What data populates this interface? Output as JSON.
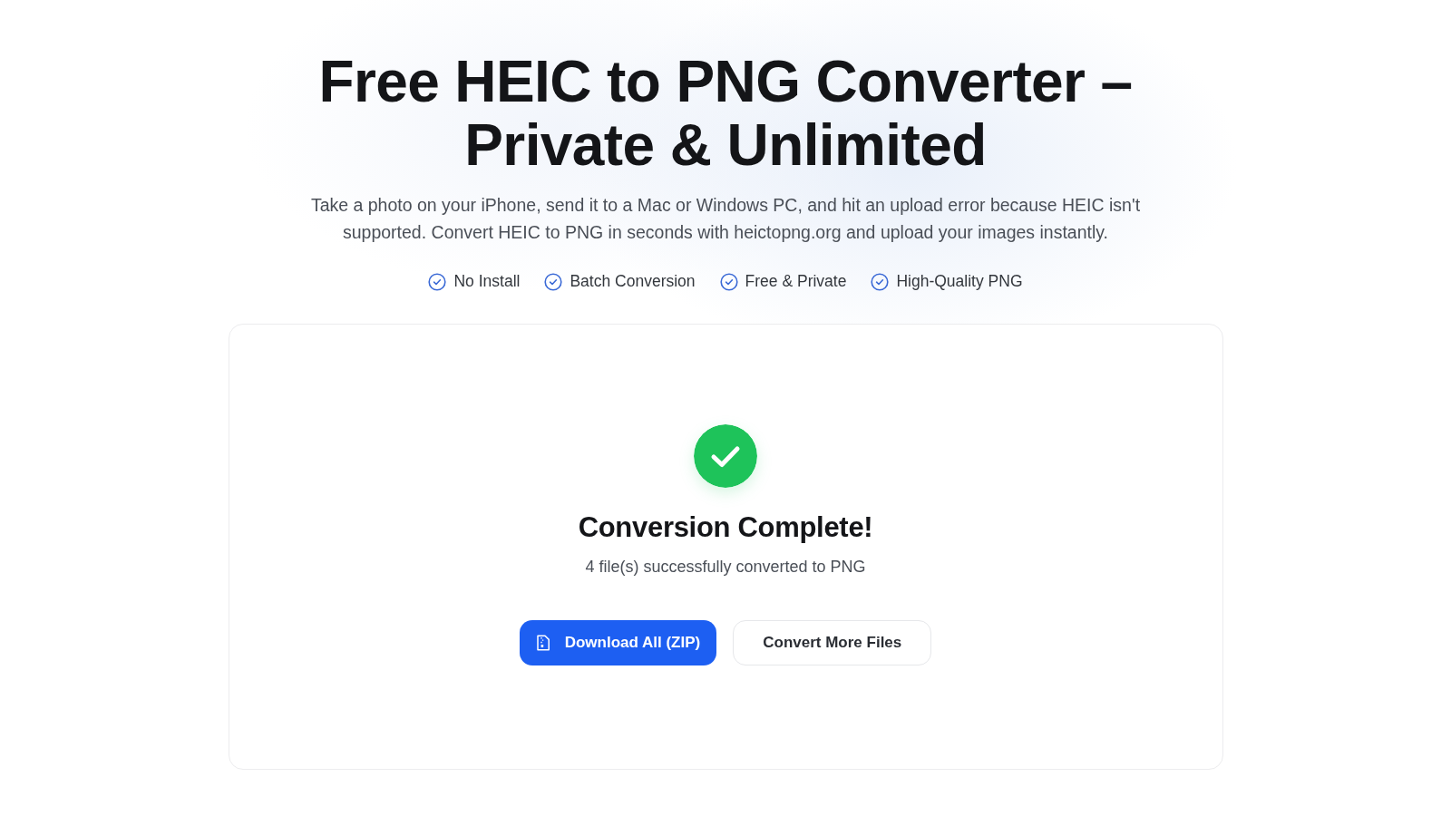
{
  "hero": {
    "title_lines": [
      "Free HEIC to PNG Converter –",
      "Private & Unlimited"
    ],
    "description": "Take a photo on your iPhone, send it to a Mac or Windows PC, and hit an upload error because HEIC isn't supported. Convert HEIC to PNG in seconds with heictopng.org and upload your images instantly.",
    "features": [
      {
        "label": "No Install"
      },
      {
        "label": "Batch Conversion"
      },
      {
        "label": "Free & Private"
      },
      {
        "label": "High-Quality PNG"
      }
    ]
  },
  "result_card": {
    "complete": true,
    "heading": "Conversion Complete!",
    "message": "4 file(s) successfully converted to PNG",
    "buttons": [
      {
        "label": "Download All (ZIP)",
        "kind": "primary"
      },
      {
        "label": "Convert More Files",
        "kind": "secondary"
      }
    ]
  }
}
